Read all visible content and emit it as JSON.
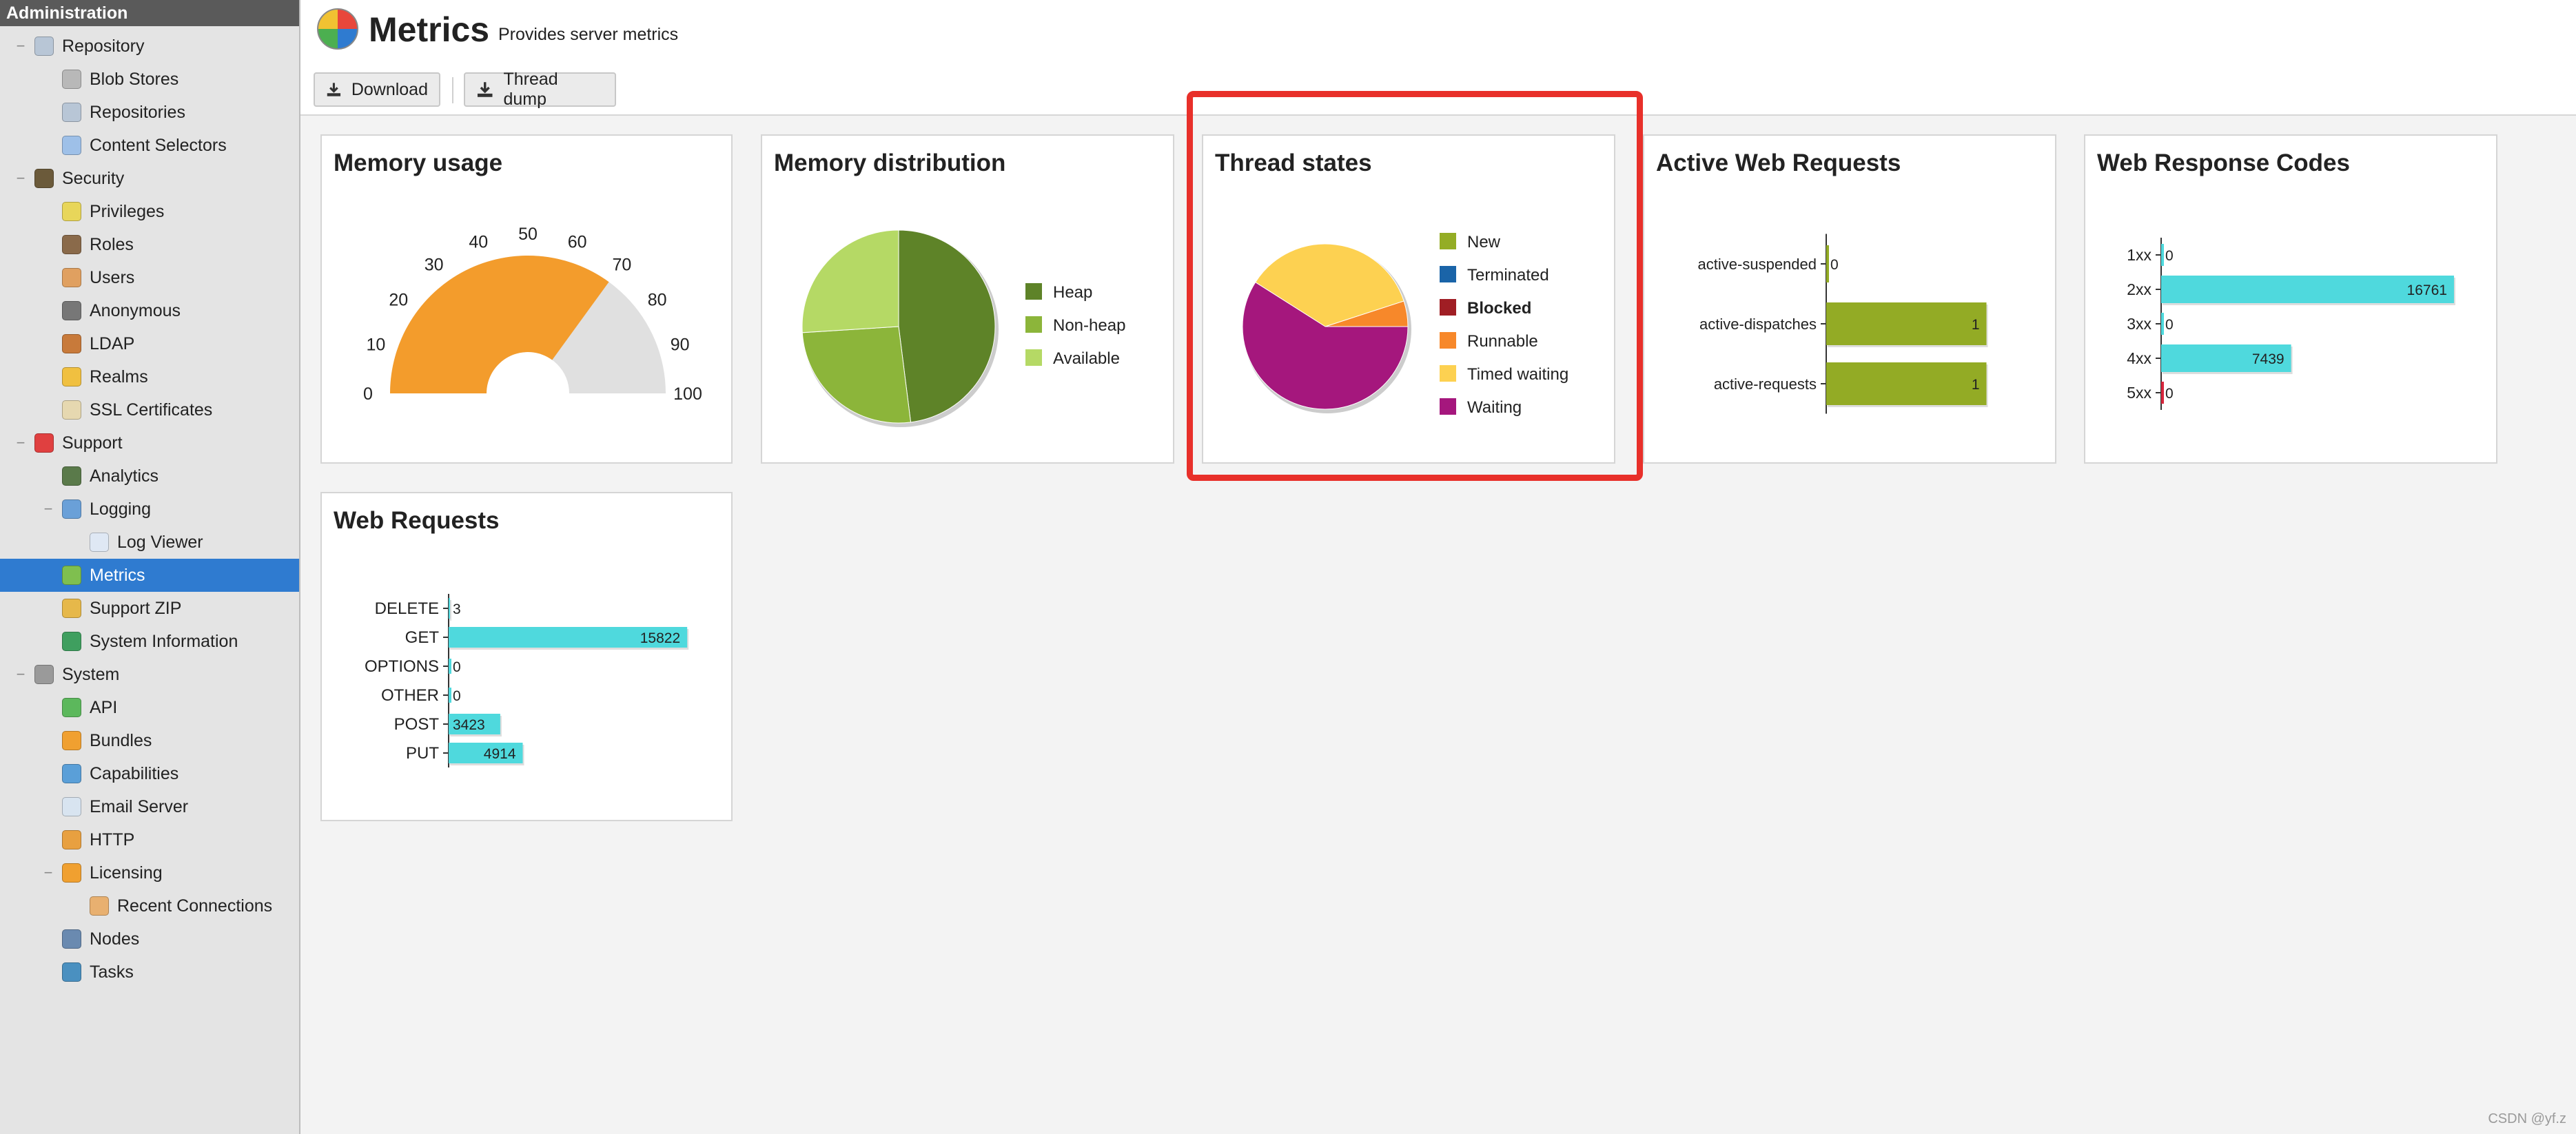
{
  "sidebar": {
    "title": "Administration",
    "items": [
      {
        "label": "Repository",
        "icon": "database-icon",
        "toggle": "−",
        "color": "#b8c6d6"
      },
      {
        "label": "Blob Stores",
        "icon": "drive-icon",
        "color": "#b8b8b8"
      },
      {
        "label": "Repositories",
        "icon": "database-icon",
        "color": "#b8c6d6"
      },
      {
        "label": "Content Selectors",
        "icon": "selector-icon",
        "color": "#9ec0e8"
      },
      {
        "label": "Security",
        "icon": "eye-icon",
        "toggle": "−",
        "color": "#6b5a3a"
      },
      {
        "label": "Privileges",
        "icon": "badge-icon",
        "color": "#e8d65a"
      },
      {
        "label": "Roles",
        "icon": "role-user-icon",
        "color": "#8a6a4a"
      },
      {
        "label": "Users",
        "icon": "users-icon",
        "color": "#e0a060"
      },
      {
        "label": "Anonymous",
        "icon": "anonymous-user-icon",
        "color": "#777777"
      },
      {
        "label": "LDAP",
        "icon": "book-icon",
        "color": "#c87a3a"
      },
      {
        "label": "Realms",
        "icon": "shield-icon",
        "color": "#f0c040"
      },
      {
        "label": "SSL Certificates",
        "icon": "certificate-icon",
        "color": "#e6d8b0"
      },
      {
        "label": "Support",
        "icon": "lifebuoy-icon",
        "toggle": "−",
        "color": "#e04040"
      },
      {
        "label": "Analytics",
        "icon": "analytics-icon",
        "color": "#5a7a4a"
      },
      {
        "label": "Logging",
        "icon": "notebook-icon",
        "toggle": "−",
        "color": "#6aa0d8"
      },
      {
        "label": "Log Viewer",
        "icon": "log-icon",
        "color": "#dfe8f4"
      },
      {
        "label": "Metrics",
        "icon": "pie-chart-icon",
        "color": "#7fbf4f"
      },
      {
        "label": "Support ZIP",
        "icon": "zip-icon",
        "color": "#e6b84a"
      },
      {
        "label": "System Information",
        "icon": "globe-icon",
        "color": "#3f9f5f"
      },
      {
        "label": "System",
        "icon": "gear-icon",
        "toggle": "−",
        "color": "#9a9a9a"
      },
      {
        "label": "API",
        "icon": "api-icon",
        "color": "#5cb85c"
      },
      {
        "label": "Bundles",
        "icon": "puzzle-icon",
        "color": "#f0a030"
      },
      {
        "label": "Capabilities",
        "icon": "cube-icon",
        "color": "#5a9fd8"
      },
      {
        "label": "Email Server",
        "icon": "mail-icon",
        "color": "#d8e4f0"
      },
      {
        "label": "HTTP",
        "icon": "truck-icon",
        "color": "#e8a040"
      },
      {
        "label": "Licensing",
        "icon": "license-icon",
        "toggle": "−",
        "color": "#f0a030"
      },
      {
        "label": "Recent Connections",
        "icon": "connections-icon",
        "color": "#e8b070"
      },
      {
        "label": "Nodes",
        "icon": "nodes-icon",
        "color": "#6a8ab0"
      },
      {
        "label": "Tasks",
        "icon": "clock-icon",
        "color": "#4a90c0"
      }
    ],
    "selected": "Metrics",
    "selected_color": "#2f7bd0"
  },
  "header": {
    "title": "Metrics",
    "subtitle": "Provides server metrics",
    "icon": "pie-chart-icon"
  },
  "toolbar": {
    "download_label": "Download",
    "thread_dump_label": "Thread dump",
    "icon": "download-icon"
  },
  "panels": {
    "memory_usage": {
      "title": "Memory usage"
    },
    "memory_distribution": {
      "title": "Memory distribution"
    },
    "thread_states": {
      "title": "Thread states"
    },
    "active_web_requests": {
      "title": "Active Web Requests"
    },
    "web_response_codes": {
      "title": "Web Response Codes"
    },
    "web_requests": {
      "title": "Web Requests"
    }
  },
  "highlight_color": "#e8302a",
  "watermark": "CSDN @yf.z",
  "chart_data": [
    {
      "id": "memory_usage",
      "type": "gauge",
      "title": "Memory usage",
      "value": 70,
      "range": [
        0,
        100
      ],
      "ticks": [
        0,
        10,
        20,
        30,
        40,
        50,
        60,
        70,
        80,
        90,
        100
      ],
      "colors": {
        "fill": "#f39c2c",
        "track": "#e0e0e0"
      }
    },
    {
      "id": "memory_distribution",
      "type": "pie",
      "title": "Memory distribution",
      "legend_position": "right",
      "slices": [
        {
          "name": "Heap",
          "value": 0.48,
          "color": "#5e8328"
        },
        {
          "name": "Non-heap",
          "value": 0.26,
          "color": "#8cb53a"
        },
        {
          "name": "Available",
          "value": 0.26,
          "color": "#b5d965"
        }
      ]
    },
    {
      "id": "thread_states",
      "type": "pie",
      "title": "Thread states",
      "legend_position": "right",
      "slices": [
        {
          "name": "New",
          "value": 0,
          "color": "#94ad25"
        },
        {
          "name": "Terminated",
          "value": 0,
          "color": "#1a64a8"
        },
        {
          "name": "Blocked",
          "value": 0,
          "color": "#a01e24",
          "bold": true
        },
        {
          "name": "Runnable",
          "value": 0.05,
          "color": "#f7882a"
        },
        {
          "name": "Timed waiting",
          "value": 0.36,
          "color": "#fdd151"
        },
        {
          "name": "Waiting",
          "value": 0.59,
          "color": "#a5177d"
        }
      ]
    },
    {
      "id": "active_web_requests",
      "type": "bar",
      "orientation": "horizontal",
      "title": "Active Web Requests",
      "categories": [
        "active-suspended",
        "active-dispatches",
        "active-requests"
      ],
      "values": [
        0,
        1,
        1
      ],
      "xlim": [
        0,
        1.2
      ],
      "color": "#93ab25"
    },
    {
      "id": "web_response_codes",
      "type": "bar",
      "orientation": "horizontal",
      "title": "Web Response Codes",
      "categories": [
        "1xx",
        "2xx",
        "3xx",
        "4xx",
        "5xx"
      ],
      "values": [
        0,
        16761,
        0,
        7439,
        0
      ],
      "xlim": [
        0,
        17000
      ],
      "color": "#4fd9dd",
      "accent_color": "#d7263d"
    },
    {
      "id": "web_requests",
      "type": "bar",
      "orientation": "horizontal",
      "title": "Web Requests",
      "categories": [
        "DELETE",
        "GET",
        "OPTIONS",
        "OTHER",
        "POST",
        "PUT"
      ],
      "values": [
        3,
        15822,
        0,
        0,
        3423,
        4914
      ],
      "xlim": [
        0,
        16500
      ],
      "color": "#4fd9dd"
    }
  ]
}
